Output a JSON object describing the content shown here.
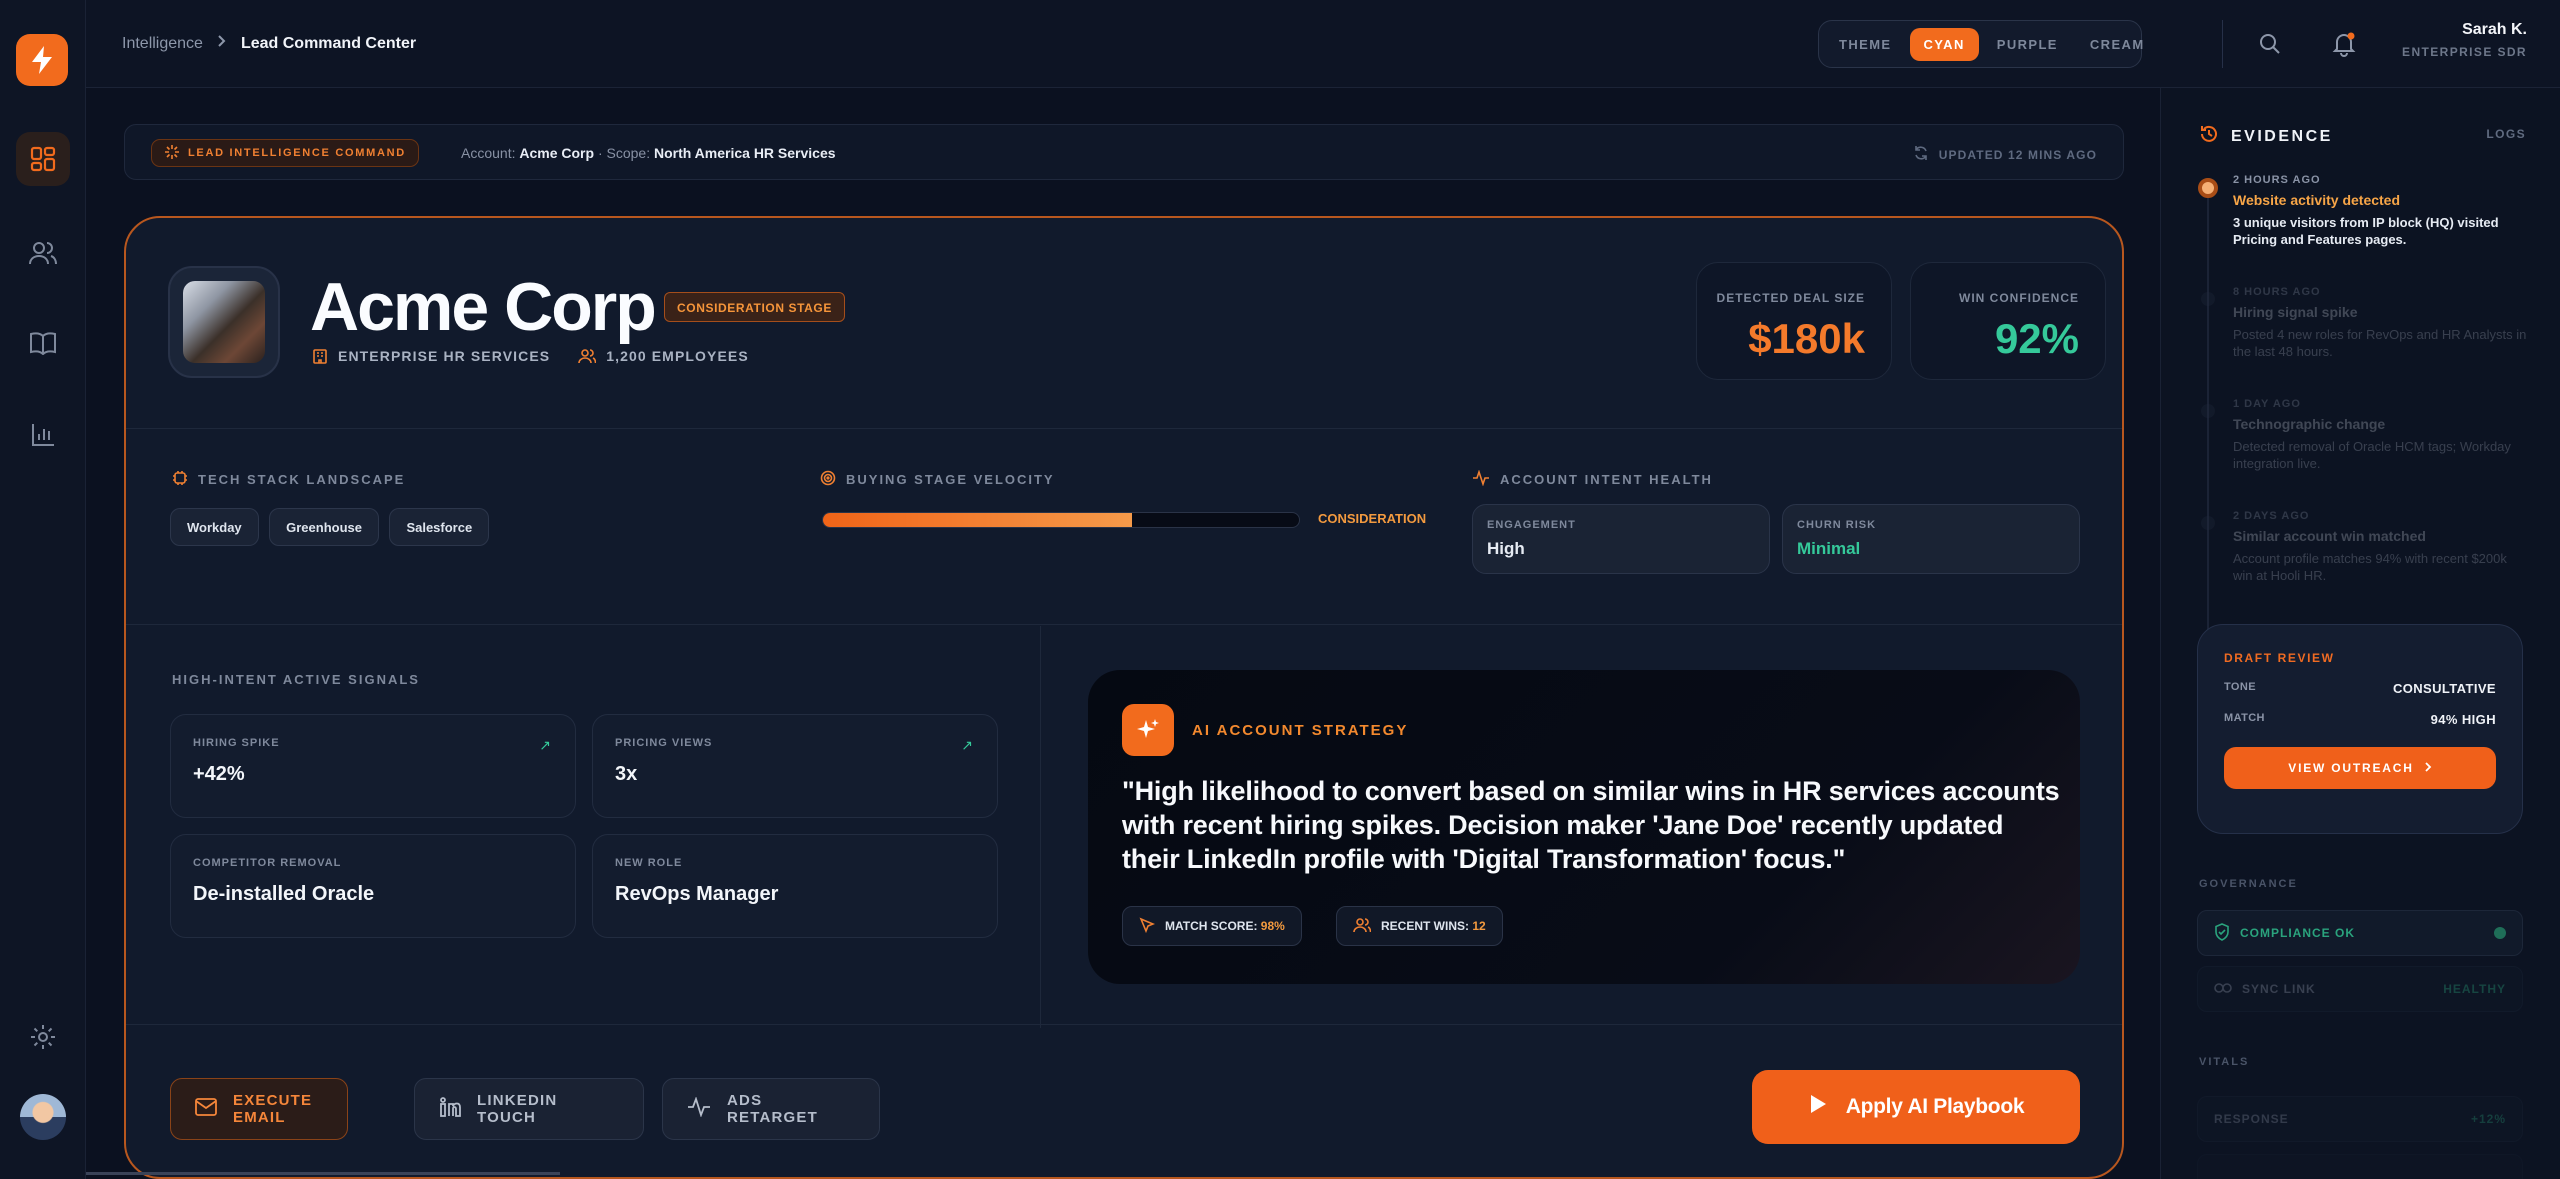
{
  "breadcrumb": {
    "parent": "Intelligence",
    "current": "Lead Command Center"
  },
  "themes": [
    {
      "label": "THEME"
    },
    {
      "label": "CYAN"
    },
    {
      "label": "PURPLE"
    },
    {
      "label": "CREAM"
    }
  ],
  "active_theme": "CYAN",
  "user": {
    "name": "Sarah K.",
    "role": "ENTERPRISE SDR"
  },
  "banner": {
    "badge": "LEAD INTELLIGENCE COMMAND",
    "account_label": "Account:",
    "account": "Acme Corp",
    "scope_label": "· Scope:",
    "scope": "North America HR Services",
    "updated": "UPDATED 12 MINS AGO"
  },
  "company": {
    "name": "Acme Corp",
    "stage": "CONSIDERATION STAGE",
    "industry": "ENTERPRISE HR SERVICES",
    "employees": "1,200 EMPLOYEES"
  },
  "kpis": {
    "deal_label": "DETECTED DEAL SIZE",
    "deal_value": "$180k",
    "win_label": "WIN CONFIDENCE",
    "win_value": "92%"
  },
  "tech": {
    "title": "TECH STACK LANDSCAPE",
    "items": [
      "Workday",
      "Greenhouse",
      "Salesforce"
    ]
  },
  "velocity": {
    "title": "BUYING STAGE VELOCITY",
    "progress": 0.65,
    "label": "CONSIDERATION"
  },
  "health": {
    "title": "ACCOUNT INTENT HEALTH",
    "engagement_label": "ENGAGEMENT",
    "engagement": "High",
    "churn_label": "CHURN RISK",
    "churn": "Minimal"
  },
  "signals": {
    "title": "HIGH-INTENT ACTIVE SIGNALS",
    "items": [
      {
        "label": "HIRING SPIKE",
        "value": "+42%"
      },
      {
        "label": "PRICING VIEWS",
        "value": "3x"
      },
      {
        "label": "COMPETITOR REMOVAL",
        "value": "De-installed Oracle"
      },
      {
        "label": "NEW ROLE",
        "value": "RevOps Manager"
      }
    ]
  },
  "ai": {
    "title": "AI ACCOUNT STRATEGY",
    "quote": "\"High likelihood to convert based on similar wins in HR services accounts with recent hiring spikes. Decision maker 'Jane Doe' recently updated their LinkedIn profile with 'Digital Transformation' focus.\"",
    "match_label": "MATCH SCORE:",
    "match": "98%",
    "wins_label": "RECENT WINS:",
    "wins": "12"
  },
  "actions": {
    "email": "EXECUTE EMAIL",
    "linkedin": "LINKEDIN TOUCH",
    "ads": "ADS RETARGET",
    "apply": "Apply AI Playbook"
  },
  "evidence": {
    "title": "EVIDENCE",
    "logs": "LOGS",
    "items": [
      {
        "time": "2 HOURS AGO",
        "title": "Website activity detected",
        "desc": "3 unique visitors from IP block (HQ) visited Pricing and Features pages."
      },
      {
        "time": "8 HOURS AGO",
        "title": "Hiring signal spike",
        "desc": "Posted 4 new roles for RevOps and HR Analysts in the last 48 hours."
      },
      {
        "time": "1 DAY AGO",
        "title": "Technographic change",
        "desc": "Detected removal of Oracle HCM tags; Workday integration live."
      },
      {
        "time": "2 DAYS AGO",
        "title": "Similar account win matched",
        "desc": "Account profile matches 94% with recent $200k win at Hooli HR."
      }
    ]
  },
  "draft": {
    "title": "DRAFT REVIEW",
    "tone_label": "TONE",
    "tone": "CONSULTATIVE",
    "match_label": "MATCH",
    "match": "94% HIGH",
    "button": "VIEW OUTREACH"
  },
  "governance": {
    "title": "GOVERNANCE",
    "compliance": "COMPLIANCE OK",
    "sync": "SYNC LINK",
    "sync_status": "HEALTHY"
  },
  "vitals": {
    "title": "VITALS",
    "response": "RESPONSE",
    "response_value": "+12%"
  },
  "colors": {
    "accent": "#f26b1d",
    "positive": "#35c99a",
    "background": "#0b1120"
  }
}
